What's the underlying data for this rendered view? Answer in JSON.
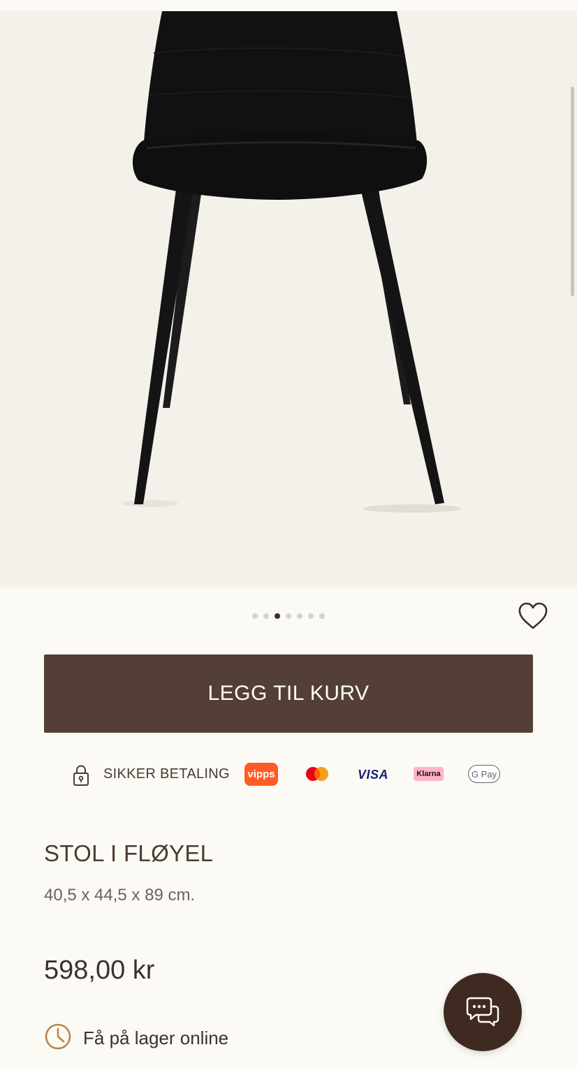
{
  "carousel": {
    "slide_count": 7,
    "active_index": 2
  },
  "actions": {
    "add_to_cart_label": "LEGG TIL KURV"
  },
  "payment": {
    "secure_label": "SIKKER BETALING",
    "methods": [
      {
        "name": "Vipps",
        "icon": "vipps-logo",
        "label": "vipps",
        "color": "#ff5b24"
      },
      {
        "name": "Mastercard",
        "icon": "mastercard-logo"
      },
      {
        "name": "Visa",
        "icon": "visa-logo",
        "label": "VISA",
        "color": "#1a1f71"
      },
      {
        "name": "Klarna",
        "icon": "klarna-logo",
        "label": "Klarna",
        "color": "#ffb3c7"
      },
      {
        "name": "Google Pay",
        "icon": "google-pay-logo",
        "label": "G Pay"
      }
    ]
  },
  "product": {
    "title": "STOL I FLØYEL",
    "dimensions": "40,5 x 44,5 x 89 cm.",
    "price": "598,00 kr",
    "stock_status": "Få på lager online"
  },
  "colors": {
    "button_bg": "#533f36",
    "chat_bg": "#3f2a22",
    "page_bg": "#fbfaf5",
    "accent_clock": "#b8874a"
  },
  "icons": {
    "wishlist": "heart-icon",
    "lock": "lock-icon",
    "clock": "clock-icon",
    "chat": "chat-icon"
  }
}
